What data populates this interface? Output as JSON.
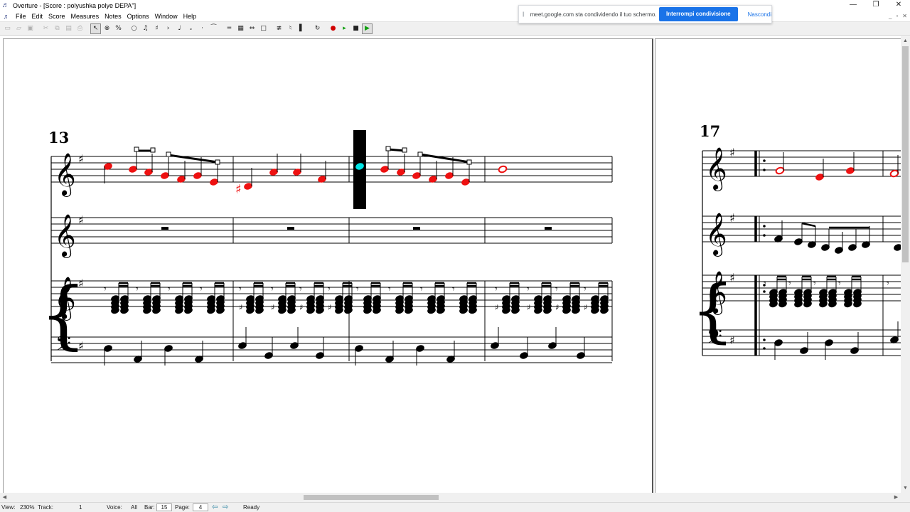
{
  "window": {
    "title": "Overture - [Score : polyushka polye DEPA\"]",
    "controls": [
      "—",
      "❐",
      "✕"
    ]
  },
  "menu": {
    "items": [
      "File",
      "Edit",
      "Score",
      "Measures",
      "Notes",
      "Options",
      "Window",
      "Help"
    ],
    "mdi_controls": [
      "_",
      "▫",
      "✕"
    ]
  },
  "toolbar": {
    "icons": [
      "new-icon",
      "open-icon",
      "save-icon",
      "cut-icon",
      "copy-icon",
      "paste-icon",
      "print-icon",
      "pointer-icon",
      "erase-icon",
      "percent-icon",
      "whole-note-icon",
      "eighth-notes-icon",
      "sharp-icon",
      "accent-icon",
      "quarter-note-icon",
      "half-note-icon",
      "staccato-icon",
      "slur-icon",
      "beam-icon",
      "grid-icon",
      "stretch-icon",
      "box-icon",
      "mixer-icon",
      "tuner-icon",
      "bar-icon",
      "loop-icon",
      "record-icon",
      "step-play-icon",
      "stop-icon",
      "play-icon"
    ]
  },
  "meet_banner": {
    "handle": "||",
    "text": "meet.google.com sta condividendo il tuo schermo.",
    "stop_label": "Interrompi condivisione",
    "hide_label": "Nascondi"
  },
  "score": {
    "measure_numbers": [
      "13",
      "17"
    ],
    "note_color": "#ee1111",
    "selection_color": "#00e5e5"
  },
  "statusbar": {
    "view_label": "View:",
    "view_value": "230%",
    "track_label": "Track:",
    "track_value": "1",
    "voice_label": "Voice:",
    "voice_value": "All",
    "bar_label": "Bar:",
    "bar_value": "15",
    "page_label": "Page:",
    "page_value": "4",
    "status_text": "Ready"
  }
}
